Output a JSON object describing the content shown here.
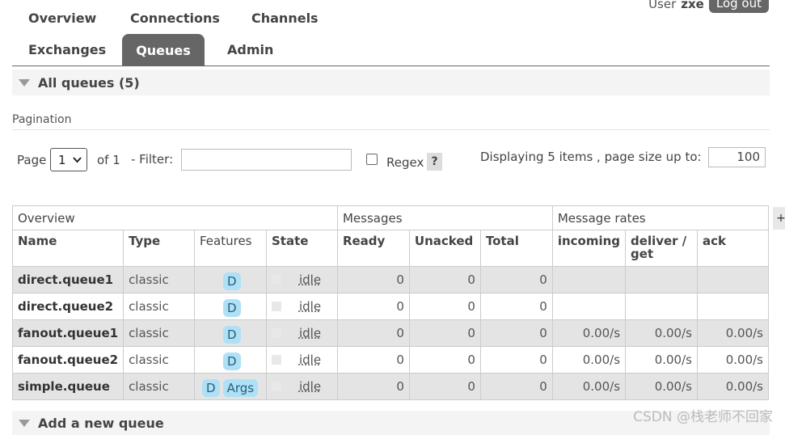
{
  "nav": {
    "row1": [
      "Overview",
      "Connections",
      "Channels"
    ],
    "row2": [
      "Exchanges",
      "Queues",
      "Admin"
    ],
    "active": "Queues"
  },
  "user": {
    "label": "User",
    "name": "zxe",
    "logout": "Log out"
  },
  "all_queues": {
    "title": "All queues (5)"
  },
  "pagination": {
    "label": "Pagination",
    "page_label": "Page",
    "page_value": "1",
    "of_label": "of 1",
    "filter_label": "- Filter:",
    "filter_value": "",
    "regex_label": "Regex",
    "help": "?",
    "displaying": "Displaying 5 items , page size up to:",
    "page_size": "100"
  },
  "table": {
    "groups": [
      "Overview",
      "Messages",
      "Message rates"
    ],
    "columns": [
      "Name",
      "Type",
      "Features",
      "State",
      "Ready",
      "Unacked",
      "Total",
      "incoming",
      "deliver / get",
      "ack"
    ],
    "rows": [
      {
        "name": "direct.queue1",
        "type": "classic",
        "features": [
          "D"
        ],
        "state": "idle",
        "ready": "0",
        "unacked": "0",
        "total": "0",
        "incoming": "",
        "deliver": "",
        "ack": ""
      },
      {
        "name": "direct.queue2",
        "type": "classic",
        "features": [
          "D"
        ],
        "state": "idle",
        "ready": "0",
        "unacked": "0",
        "total": "0",
        "incoming": "",
        "deliver": "",
        "ack": ""
      },
      {
        "name": "fanout.queue1",
        "type": "classic",
        "features": [
          "D"
        ],
        "state": "idle",
        "ready": "0",
        "unacked": "0",
        "total": "0",
        "incoming": "0.00/s",
        "deliver": "0.00/s",
        "ack": "0.00/s"
      },
      {
        "name": "fanout.queue2",
        "type": "classic",
        "features": [
          "D"
        ],
        "state": "idle",
        "ready": "0",
        "unacked": "0",
        "total": "0",
        "incoming": "0.00/s",
        "deliver": "0.00/s",
        "ack": "0.00/s"
      },
      {
        "name": "simple.queue",
        "type": "classic",
        "features": [
          "D",
          "Args"
        ],
        "state": "idle",
        "ready": "0",
        "unacked": "0",
        "total": "0",
        "incoming": "0.00/s",
        "deliver": "0.00/s",
        "ack": "0.00/s"
      }
    ],
    "plus": "+"
  },
  "add_queue": {
    "title": "Add a new queue"
  },
  "watermark": "CSDN @栈老师不回家"
}
